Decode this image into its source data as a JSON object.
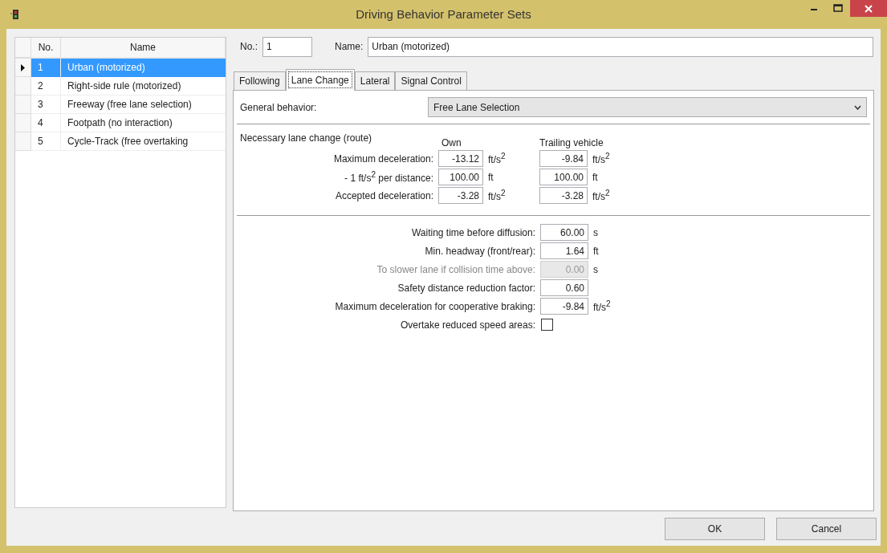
{
  "window": {
    "title": "Driving Behavior Parameter Sets"
  },
  "sets": {
    "columns": [
      "No.",
      "Name"
    ],
    "rows": [
      {
        "no": "1",
        "name": "Urban (motorized)",
        "selected": true
      },
      {
        "no": "2",
        "name": "Right-side rule (motorized)",
        "selected": false
      },
      {
        "no": "3",
        "name": "Freeway (free lane selection)",
        "selected": false
      },
      {
        "no": "4",
        "name": "Footpath (no interaction)",
        "selected": false
      },
      {
        "no": "5",
        "name": "Cycle-Track (free overtaking",
        "selected": false
      }
    ]
  },
  "header": {
    "no_label": "No.:",
    "no_value": "1",
    "name_label": "Name:",
    "name_value": "Urban (motorized)"
  },
  "tabs": [
    {
      "label": "Following",
      "selected": false
    },
    {
      "label": "Lane Change",
      "selected": true
    },
    {
      "label": "Lateral",
      "selected": false
    },
    {
      "label": "Signal Control",
      "selected": false
    }
  ],
  "general_behavior": {
    "label": "General behavior:",
    "value": "Free Lane Selection"
  },
  "necessary_lane_change": {
    "title": "Necessary lane change (route)",
    "columns": [
      "Own",
      "Trailing vehicle"
    ],
    "rows": [
      {
        "label": "Maximum deceleration:",
        "own": "-13.12",
        "own_unit": "ft/s$^{2}$",
        "trailing": "-9.84",
        "trailing_unit": "ft/s$^{2}$"
      },
      {
        "label": "- 1 ft/s$^{2}$ per distance:",
        "own": "100.00",
        "own_unit": "ft",
        "trailing": "100.00",
        "trailing_unit": "ft"
      },
      {
        "label": "Accepted deceleration:",
        "own": "-3.28",
        "own_unit": "ft/s$^{2}$",
        "trailing": "-3.28",
        "trailing_unit": "ft/s$^{2}$"
      }
    ]
  },
  "parameters": [
    {
      "kind": "field",
      "label": "Waiting time before diffusion:",
      "value": "60.00",
      "unit": "s",
      "disabled": false
    },
    {
      "kind": "field",
      "label": "Min. headway (front/rear):",
      "value": "1.64",
      "unit": "ft",
      "disabled": false
    },
    {
      "kind": "field",
      "label": "To slower lane if collision time above:",
      "value": "0.00",
      "unit": "s",
      "disabled": true
    },
    {
      "kind": "field",
      "label": "Safety distance reduction factor:",
      "value": "0.60",
      "disabled": false
    },
    {
      "kind": "field",
      "label": "Maximum deceleration for cooperative braking:",
      "value": "-9.84",
      "unit": "ft/s$^{2}$",
      "disabled": false
    },
    {
      "kind": "checkbox",
      "label": "Overtake reduced speed areas:",
      "checked": false
    }
  ],
  "buttons": [
    "OK",
    "Cancel"
  ]
}
